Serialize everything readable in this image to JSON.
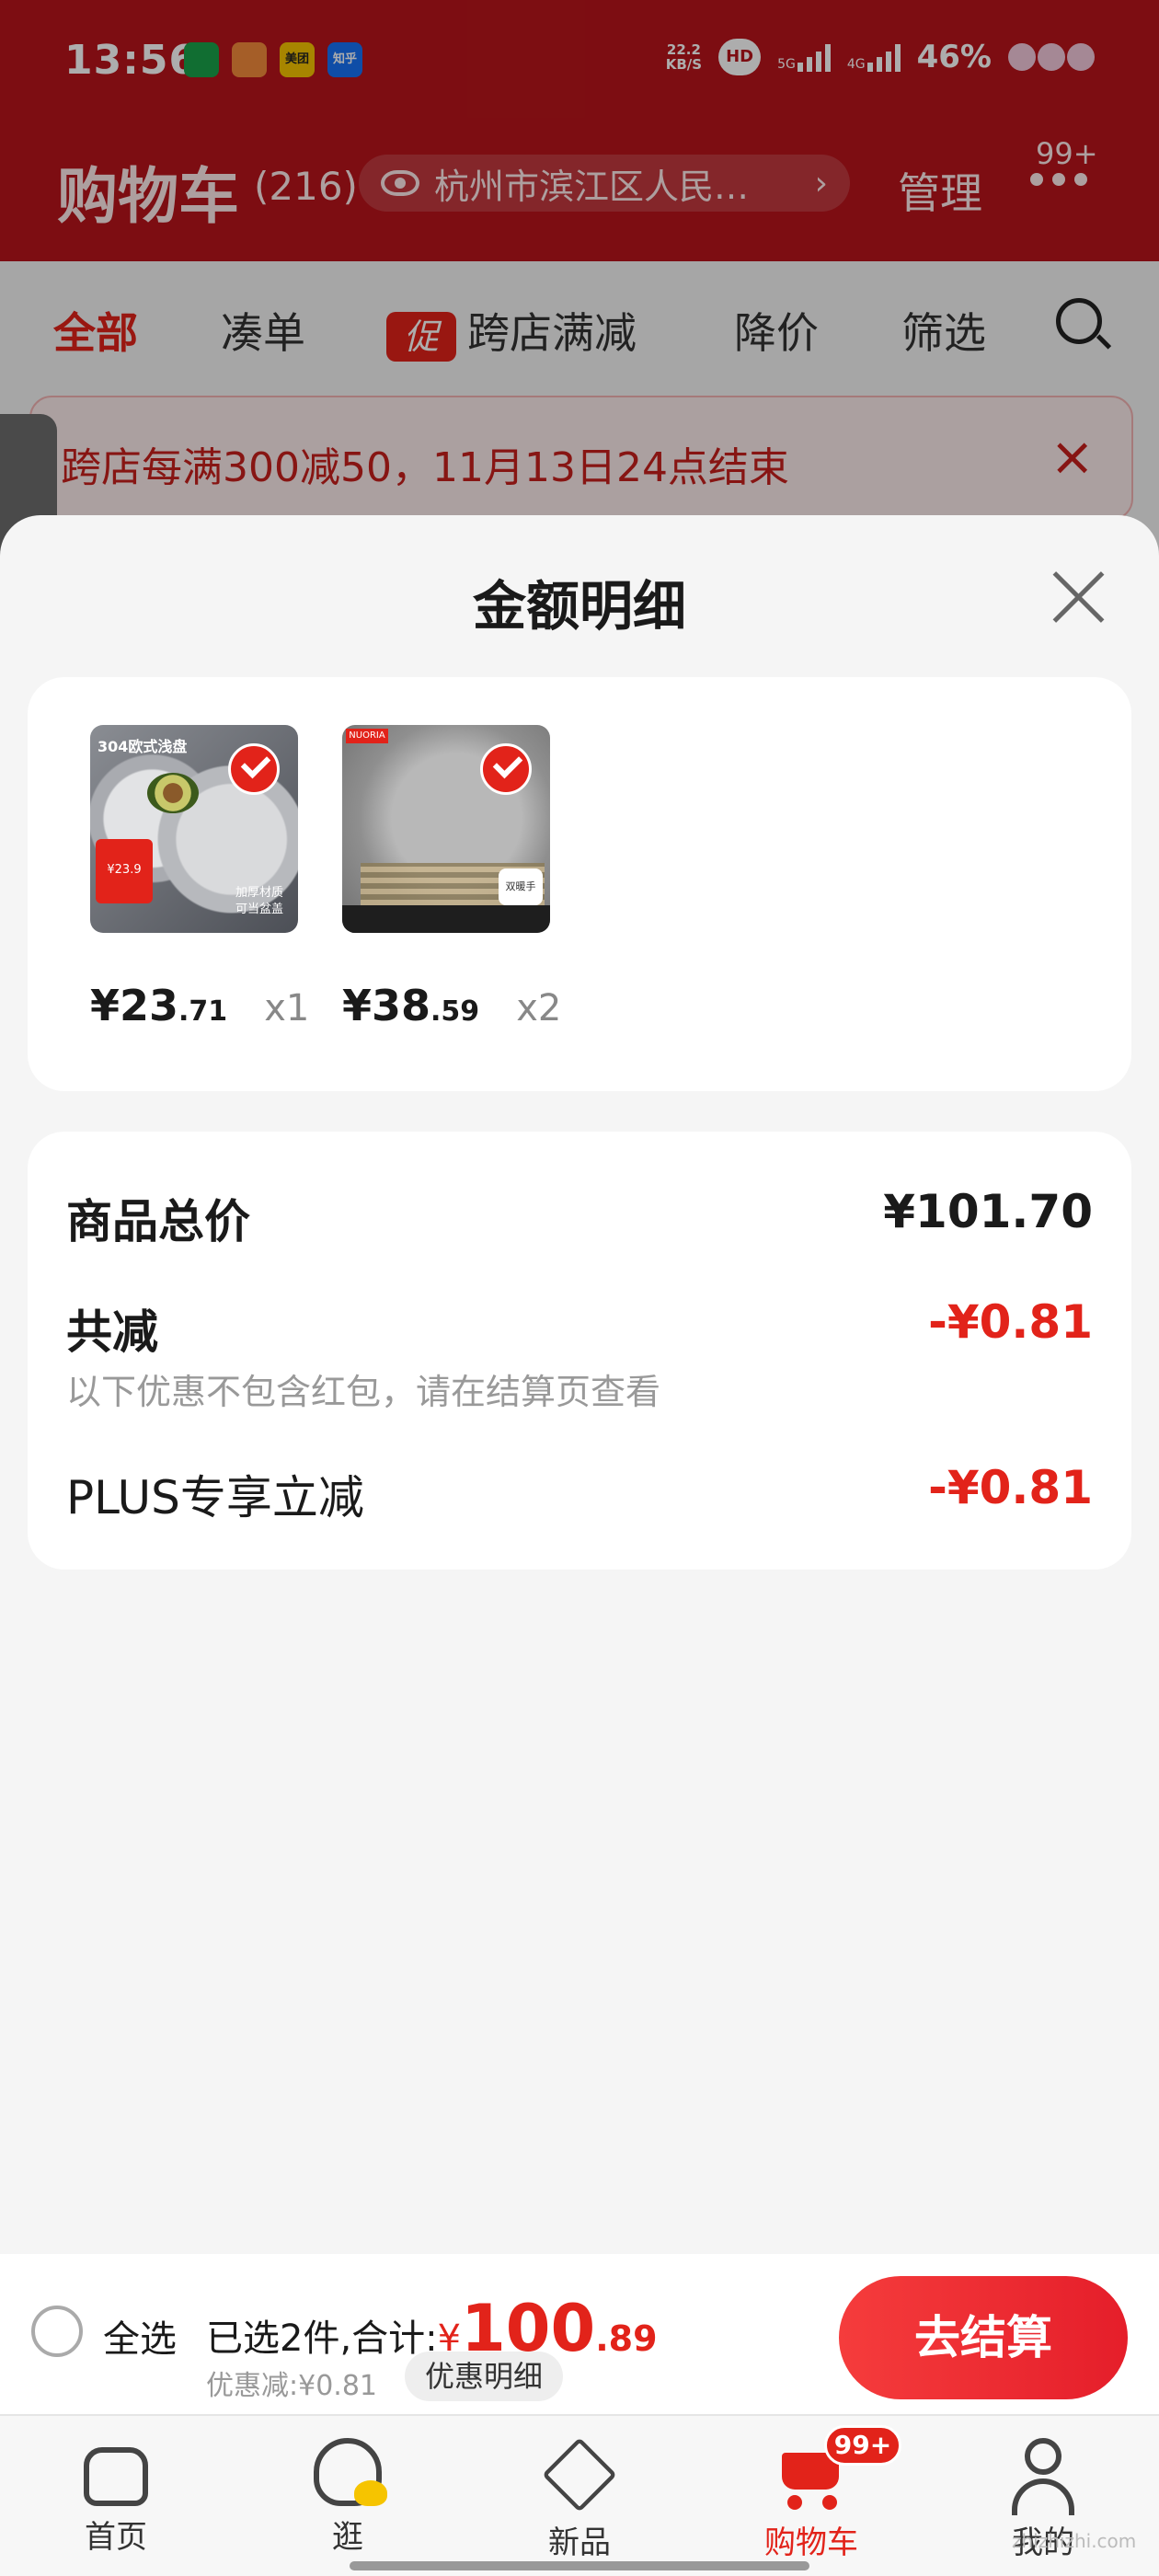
{
  "status_bar": {
    "time": "13:56",
    "app_icons": [
      {
        "name": "postal-app-icon",
        "color": "#1aa34a",
        "text": ""
      },
      {
        "name": "pet-app-icon",
        "color": "#f38b3c",
        "text": ""
      },
      {
        "name": "meituan-app-icon",
        "color": "#f6c400",
        "text": "美团"
      },
      {
        "name": "zhihu-app-icon",
        "color": "#1772f6",
        "text": "知乎"
      }
    ],
    "net_speed_value": "22.2",
    "net_speed_unit": "KB/S",
    "hd_label": "HD",
    "signal1_label": "5G",
    "signal2_label": "4G",
    "battery": "46%"
  },
  "header": {
    "title": "购物车",
    "count": "(216)",
    "address": "杭州市滨江区人民…",
    "manage": "管理",
    "more_badge": "99+"
  },
  "filters": {
    "all": "全部",
    "bundle": "凑单",
    "promo_tag": "促",
    "cross_store": "跨店满减",
    "price_drop": "降价",
    "filter": "筛选"
  },
  "promo_banner": {
    "text": "跨店每满300减50，11月13日24点结束",
    "close": "×"
  },
  "sheet": {
    "title": "金额明细",
    "items": [
      {
        "image_label": "304欧式浅盘",
        "image_price": "¥23.9",
        "image_side": "加厚材质 可当盆盖",
        "price_int": "¥23",
        "price_dec": ".71",
        "qty": "x1"
      },
      {
        "image_brand": "NUORIA",
        "image_tag": "双暖手",
        "price_int": "¥38",
        "price_dec": ".59",
        "qty": "x2"
      }
    ],
    "summary": {
      "total_label": "商品总价",
      "total_value": "¥101.70",
      "reduce_label": "共减",
      "reduce_value": "-¥0.81",
      "reduce_note": "以下优惠不包含红包，请在结算页查看",
      "plus_label": "PLUS专享立减",
      "plus_value": "-¥0.81"
    }
  },
  "checkout": {
    "select_all": "全选",
    "selected_text": "已选2件,合计:",
    "currency": "¥",
    "total_int": "100",
    "total_dec": ".89",
    "discount": "优惠减:¥0.81",
    "detail_button": "优惠明细",
    "checkout_button": "去结算"
  },
  "tabbar": {
    "home": "首页",
    "stroll": "逛",
    "new": "新品",
    "cart": "购物车",
    "cart_badge": "99+",
    "me": "我的"
  },
  "watermark": "zhizhizhi.com",
  "colors": {
    "brand_red": "#e2231a",
    "header_red": "#b8141b"
  }
}
